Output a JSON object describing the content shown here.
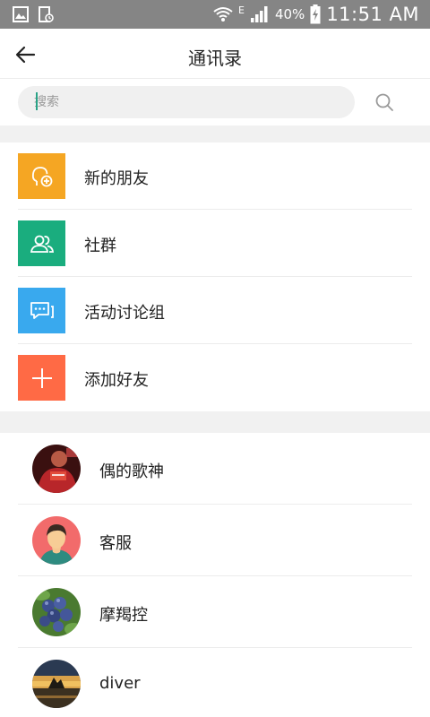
{
  "status_bar": {
    "network_type": "E",
    "battery_percent": "40%",
    "time": "11:51 AM"
  },
  "header": {
    "title": "通讯录"
  },
  "search": {
    "placeholder": "搜索"
  },
  "features": [
    {
      "label": "新的朋友",
      "color": "#f5a623",
      "icon": "new-friend-icon"
    },
    {
      "label": "社群",
      "color": "#1aad7e",
      "icon": "community-icon"
    },
    {
      "label": "活动讨论组",
      "color": "#39a9ee",
      "icon": "chat-group-icon"
    },
    {
      "label": "添加好友",
      "color": "#ff6a45",
      "icon": "plus-icon"
    }
  ],
  "contacts": [
    {
      "name": "偶的歌神",
      "avatar": "red-shirt-photo-avatar"
    },
    {
      "name": "客服",
      "avatar": "person-illustration-avatar"
    },
    {
      "name": "摩羯控",
      "avatar": "blueberries-photo-avatar"
    },
    {
      "name": "diver",
      "avatar": "sunset-photo-avatar"
    }
  ]
}
